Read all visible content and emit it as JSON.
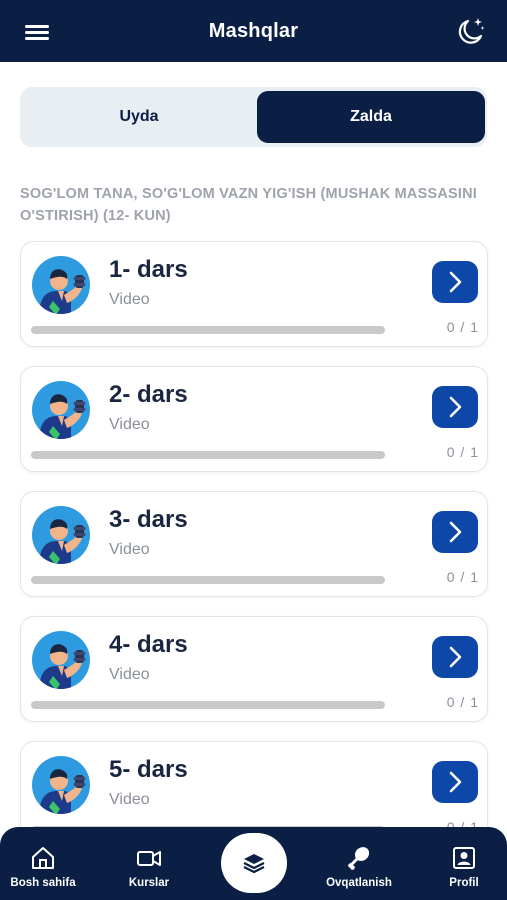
{
  "header": {
    "title": "Mashqlar",
    "menu_icon": "hamburger-menu-icon",
    "theme_icon": "moon-stars-icon"
  },
  "tabs": [
    {
      "label": "Uyda",
      "selected": false
    },
    {
      "label": "Zalda",
      "selected": true
    }
  ],
  "course": {
    "title": "SOG'LOM TANA, SO'G'LOM VAZN YIG'ISH (MUSHAK MASSASINI O'STIRISH) (12- KUN)"
  },
  "lessons": [
    {
      "title": "1- dars",
      "subtitle": "Video",
      "progress_text": "0 / 1",
      "progress": 0
    },
    {
      "title": "2- dars",
      "subtitle": "Video",
      "progress_text": "0 / 1",
      "progress": 0
    },
    {
      "title": "3- dars",
      "subtitle": "Video",
      "progress_text": "0 / 1",
      "progress": 0
    },
    {
      "title": "4- dars",
      "subtitle": "Video",
      "progress_text": "0 / 1",
      "progress": 0
    },
    {
      "title": "5- dars",
      "subtitle": "Video",
      "progress_text": "0 / 1",
      "progress": 0
    }
  ],
  "bottom_nav": {
    "items": [
      {
        "label": "Bosh sahifa",
        "icon": "home-icon"
      },
      {
        "label": "Kurslar",
        "icon": "video-camera-icon"
      },
      {
        "label": "Ovqatlanish",
        "icon": "drumstick-icon"
      },
      {
        "label": "Profil",
        "icon": "profile-card-icon"
      }
    ],
    "center_icon": "layers-icon"
  },
  "colors": {
    "navy": "#0b1f44",
    "accent_blue": "#0d47a8",
    "muted_text": "#9ea3ab",
    "progress_track": "#c9c9c9"
  }
}
